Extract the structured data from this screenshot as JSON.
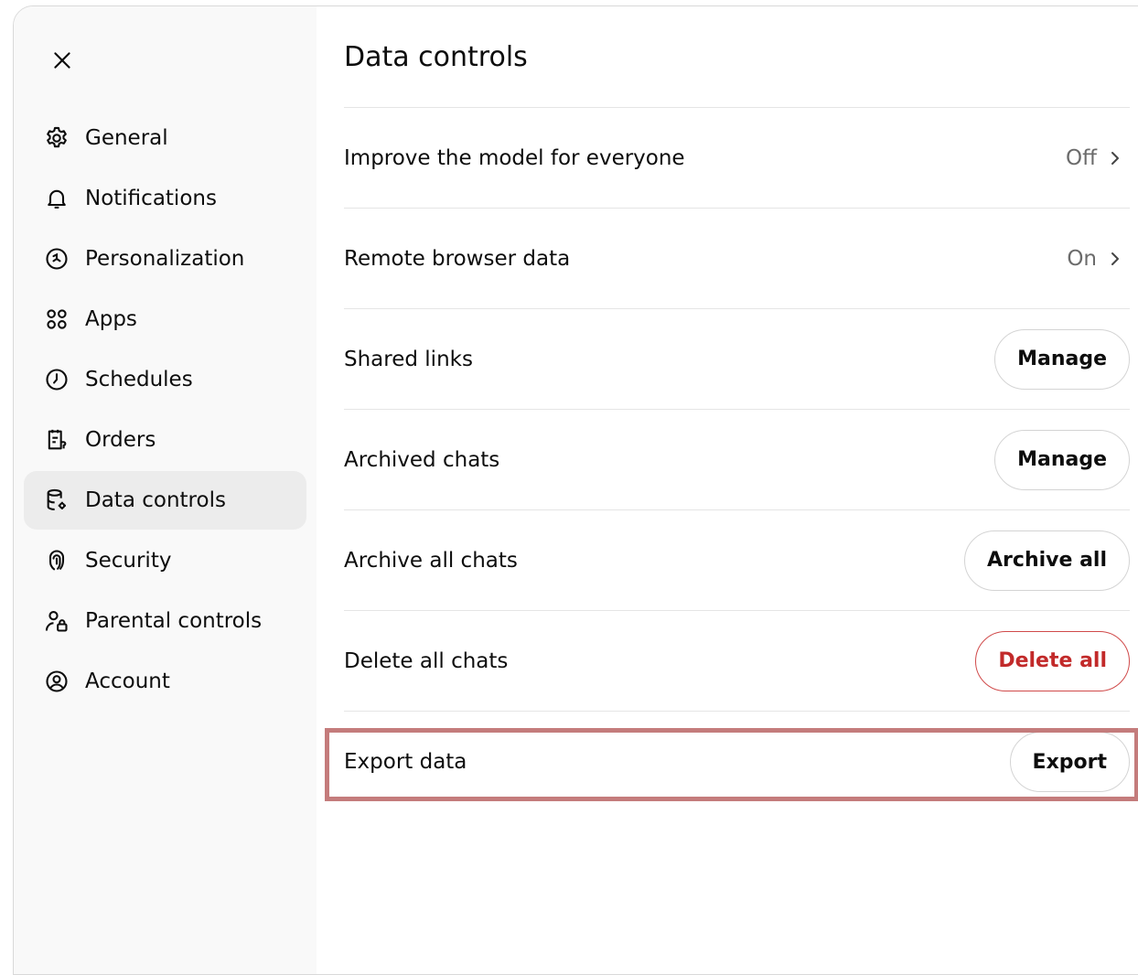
{
  "sidebar": {
    "close_icon": "close-icon",
    "items": [
      {
        "label": "General",
        "icon": "gear-icon"
      },
      {
        "label": "Notifications",
        "icon": "bell-icon"
      },
      {
        "label": "Personalization",
        "icon": "personalization-icon"
      },
      {
        "label": "Apps",
        "icon": "apps-grid-icon"
      },
      {
        "label": "Schedules",
        "icon": "clock-icon"
      },
      {
        "label": "Orders",
        "icon": "receipt-icon"
      },
      {
        "label": "Data controls",
        "icon": "database-gear-icon",
        "active": true
      },
      {
        "label": "Security",
        "icon": "fingerprint-icon"
      },
      {
        "label": "Parental controls",
        "icon": "user-lock-icon"
      },
      {
        "label": "Account",
        "icon": "account-circle-icon"
      }
    ]
  },
  "main": {
    "title": "Data controls",
    "rows": [
      {
        "label": "Improve the model for everyone",
        "value": "Off"
      },
      {
        "label": "Remote browser data",
        "value": "On"
      },
      {
        "label": "Shared links",
        "button": "Manage"
      },
      {
        "label": "Archived chats",
        "button": "Manage"
      },
      {
        "label": "Archive all chats",
        "button": "Archive all"
      },
      {
        "label": "Delete all chats",
        "button": "Delete all"
      },
      {
        "label": "Export data",
        "button": "Export"
      }
    ]
  },
  "colors": {
    "danger": "#c22a2a",
    "highlight": "#c47c7c",
    "sidebar_bg": "#f9f9f9",
    "active_bg": "#ececec"
  }
}
